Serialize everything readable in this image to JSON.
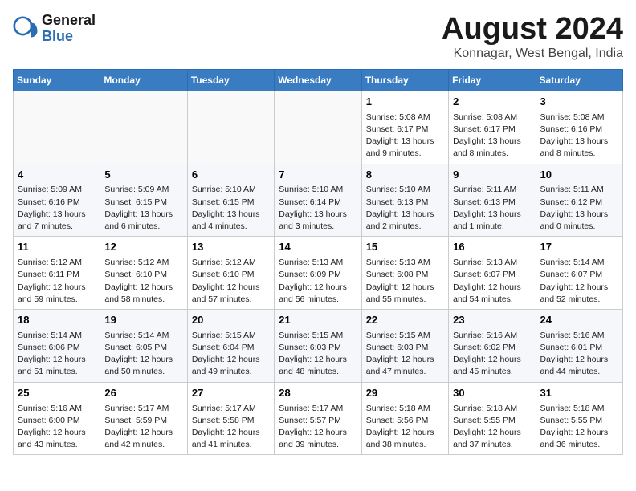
{
  "logo": {
    "general": "General",
    "blue": "Blue"
  },
  "title": "August 2024",
  "subtitle": "Konnagar, West Bengal, India",
  "days_of_week": [
    "Sunday",
    "Monday",
    "Tuesday",
    "Wednesday",
    "Thursday",
    "Friday",
    "Saturday"
  ],
  "weeks": [
    [
      {
        "day": null,
        "content": null
      },
      {
        "day": null,
        "content": null
      },
      {
        "day": null,
        "content": null
      },
      {
        "day": null,
        "content": null
      },
      {
        "day": "1",
        "content": "Sunrise: 5:08 AM\nSunset: 6:17 PM\nDaylight: 13 hours\nand 9 minutes."
      },
      {
        "day": "2",
        "content": "Sunrise: 5:08 AM\nSunset: 6:17 PM\nDaylight: 13 hours\nand 8 minutes."
      },
      {
        "day": "3",
        "content": "Sunrise: 5:08 AM\nSunset: 6:16 PM\nDaylight: 13 hours\nand 8 minutes."
      }
    ],
    [
      {
        "day": "4",
        "content": "Sunrise: 5:09 AM\nSunset: 6:16 PM\nDaylight: 13 hours\nand 7 minutes."
      },
      {
        "day": "5",
        "content": "Sunrise: 5:09 AM\nSunset: 6:15 PM\nDaylight: 13 hours\nand 6 minutes."
      },
      {
        "day": "6",
        "content": "Sunrise: 5:10 AM\nSunset: 6:15 PM\nDaylight: 13 hours\nand 4 minutes."
      },
      {
        "day": "7",
        "content": "Sunrise: 5:10 AM\nSunset: 6:14 PM\nDaylight: 13 hours\nand 3 minutes."
      },
      {
        "day": "8",
        "content": "Sunrise: 5:10 AM\nSunset: 6:13 PM\nDaylight: 13 hours\nand 2 minutes."
      },
      {
        "day": "9",
        "content": "Sunrise: 5:11 AM\nSunset: 6:13 PM\nDaylight: 13 hours\nand 1 minute."
      },
      {
        "day": "10",
        "content": "Sunrise: 5:11 AM\nSunset: 6:12 PM\nDaylight: 13 hours\nand 0 minutes."
      }
    ],
    [
      {
        "day": "11",
        "content": "Sunrise: 5:12 AM\nSunset: 6:11 PM\nDaylight: 12 hours\nand 59 minutes."
      },
      {
        "day": "12",
        "content": "Sunrise: 5:12 AM\nSunset: 6:10 PM\nDaylight: 12 hours\nand 58 minutes."
      },
      {
        "day": "13",
        "content": "Sunrise: 5:12 AM\nSunset: 6:10 PM\nDaylight: 12 hours\nand 57 minutes."
      },
      {
        "day": "14",
        "content": "Sunrise: 5:13 AM\nSunset: 6:09 PM\nDaylight: 12 hours\nand 56 minutes."
      },
      {
        "day": "15",
        "content": "Sunrise: 5:13 AM\nSunset: 6:08 PM\nDaylight: 12 hours\nand 55 minutes."
      },
      {
        "day": "16",
        "content": "Sunrise: 5:13 AM\nSunset: 6:07 PM\nDaylight: 12 hours\nand 54 minutes."
      },
      {
        "day": "17",
        "content": "Sunrise: 5:14 AM\nSunset: 6:07 PM\nDaylight: 12 hours\nand 52 minutes."
      }
    ],
    [
      {
        "day": "18",
        "content": "Sunrise: 5:14 AM\nSunset: 6:06 PM\nDaylight: 12 hours\nand 51 minutes."
      },
      {
        "day": "19",
        "content": "Sunrise: 5:14 AM\nSunset: 6:05 PM\nDaylight: 12 hours\nand 50 minutes."
      },
      {
        "day": "20",
        "content": "Sunrise: 5:15 AM\nSunset: 6:04 PM\nDaylight: 12 hours\nand 49 minutes."
      },
      {
        "day": "21",
        "content": "Sunrise: 5:15 AM\nSunset: 6:03 PM\nDaylight: 12 hours\nand 48 minutes."
      },
      {
        "day": "22",
        "content": "Sunrise: 5:15 AM\nSunset: 6:03 PM\nDaylight: 12 hours\nand 47 minutes."
      },
      {
        "day": "23",
        "content": "Sunrise: 5:16 AM\nSunset: 6:02 PM\nDaylight: 12 hours\nand 45 minutes."
      },
      {
        "day": "24",
        "content": "Sunrise: 5:16 AM\nSunset: 6:01 PM\nDaylight: 12 hours\nand 44 minutes."
      }
    ],
    [
      {
        "day": "25",
        "content": "Sunrise: 5:16 AM\nSunset: 6:00 PM\nDaylight: 12 hours\nand 43 minutes."
      },
      {
        "day": "26",
        "content": "Sunrise: 5:17 AM\nSunset: 5:59 PM\nDaylight: 12 hours\nand 42 minutes."
      },
      {
        "day": "27",
        "content": "Sunrise: 5:17 AM\nSunset: 5:58 PM\nDaylight: 12 hours\nand 41 minutes."
      },
      {
        "day": "28",
        "content": "Sunrise: 5:17 AM\nSunset: 5:57 PM\nDaylight: 12 hours\nand 39 minutes."
      },
      {
        "day": "29",
        "content": "Sunrise: 5:18 AM\nSunset: 5:56 PM\nDaylight: 12 hours\nand 38 minutes."
      },
      {
        "day": "30",
        "content": "Sunrise: 5:18 AM\nSunset: 5:55 PM\nDaylight: 12 hours\nand 37 minutes."
      },
      {
        "day": "31",
        "content": "Sunrise: 5:18 AM\nSunset: 5:55 PM\nDaylight: 12 hours\nand 36 minutes."
      }
    ]
  ]
}
